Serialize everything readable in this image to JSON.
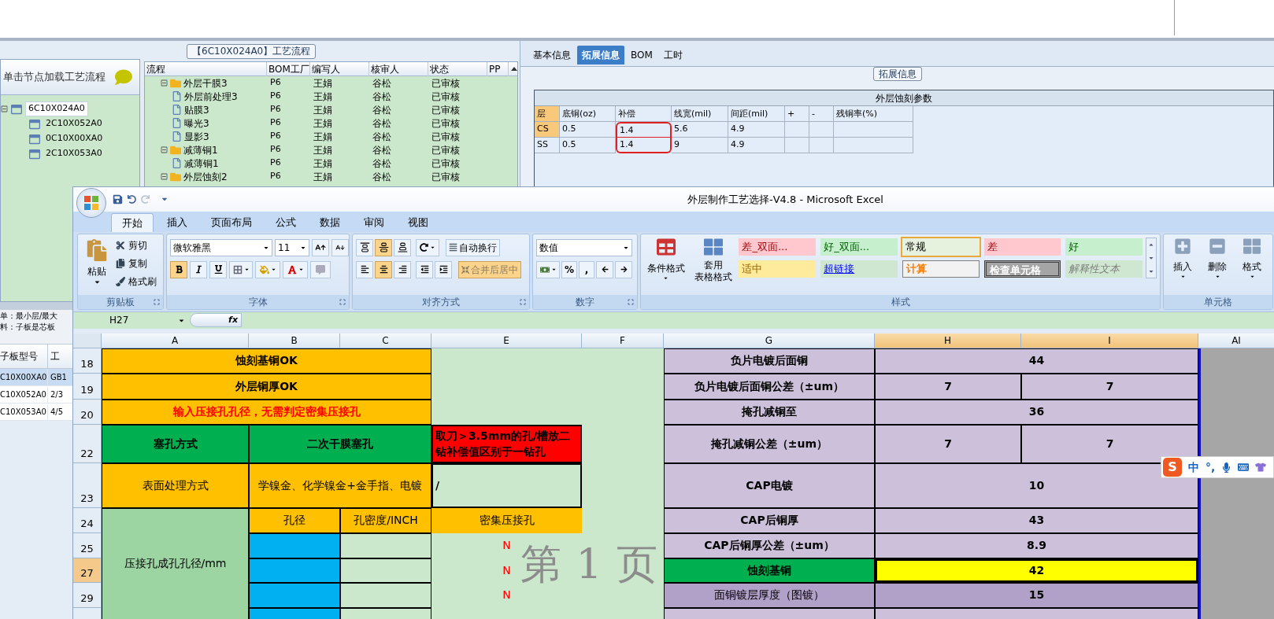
{
  "tree_panel": {
    "title": "单击节点加载工艺流程",
    "nodes": [
      {
        "label": "6C10X024A0",
        "expanded": true,
        "selected": true,
        "children": [
          {
            "label": "2C10X052A0",
            "selected": false
          },
          {
            "label": "0C10X00XA0",
            "selected": false
          },
          {
            "label": "2C10X053A0",
            "selected": false
          }
        ]
      }
    ]
  },
  "process_panel": {
    "title": "【6C10X024A0】工艺流程",
    "columns": [
      "流程",
      "BOM工厂",
      "编写人",
      "核审人",
      "状态",
      "PP"
    ],
    "rows": [
      {
        "kind": "folder",
        "name": "外层干膜3",
        "factory": "P6",
        "writer": "王娟",
        "reviewer": "谷松",
        "status": "已审核",
        "expanded": true,
        "children": [
          {
            "kind": "step",
            "name": "外层前处理3",
            "factory": "P6",
            "writer": "王娟",
            "reviewer": "谷松",
            "status": "已审核"
          },
          {
            "kind": "step",
            "name": "贴膜3",
            "factory": "P6",
            "writer": "王娟",
            "reviewer": "谷松",
            "status": "已审核"
          },
          {
            "kind": "step",
            "name": "曝光3",
            "factory": "P6",
            "writer": "王娟",
            "reviewer": "谷松",
            "status": "已审核"
          },
          {
            "kind": "step",
            "name": "显影3",
            "factory": "P6",
            "writer": "王娟",
            "reviewer": "谷松",
            "status": "已审核"
          }
        ]
      },
      {
        "kind": "folder",
        "name": "减薄铜1",
        "factory": "P6",
        "writer": "王娟",
        "reviewer": "谷松",
        "status": "已审核",
        "expanded": true,
        "children": [
          {
            "kind": "step",
            "name": "减薄铜1",
            "factory": "P6",
            "writer": "王娟",
            "reviewer": "谷松",
            "status": "已审核"
          }
        ]
      },
      {
        "kind": "folder",
        "name": "外层蚀刻2",
        "factory": "P6",
        "writer": "王娟",
        "reviewer": "谷松",
        "status": "已审核",
        "expanded": true
      }
    ]
  },
  "background_list": {
    "lines": [
      "单：最小层/最大",
      "料：子板是芯板"
    ],
    "columns": [
      "子板型号",
      "工"
    ],
    "rows": [
      {
        "cells": [
          "C10X00XA0",
          "GB1"
        ],
        "selected": true
      },
      {
        "cells": [
          "C10X052A0",
          "2/3"
        ],
        "selected": false
      },
      {
        "cells": [
          "C10X053A0",
          "4/5"
        ],
        "selected": false
      }
    ]
  },
  "detail_panel": {
    "tabs": [
      {
        "label": "基本信息",
        "selected": false
      },
      {
        "label": "拓展信息",
        "selected": true
      },
      {
        "label": "BOM",
        "selected": false
      },
      {
        "label": "工时",
        "selected": false
      }
    ],
    "group_title": "拓展信息",
    "table": {
      "title": "外层蚀刻参数",
      "columns": [
        "层",
        "底铜(oz)",
        "补偿",
        "线宽(mil)",
        "间距(mil)",
        "+",
        "-",
        "残铜率(%)"
      ],
      "rows": [
        {
          "selected": true,
          "cells": [
            {
              "text": "CS",
              "circled": false
            },
            {
              "text": "0.5",
              "circled": false
            },
            {
              "text": "1.4",
              "circled": true
            },
            {
              "text": "5.6",
              "circled": false
            },
            {
              "text": "4.9",
              "circled": false
            }
          ]
        },
        {
          "selected": false,
          "cells": [
            {
              "text": "SS",
              "circled": false
            },
            {
              "text": "0.5",
              "circled": false
            },
            {
              "text": "1.4",
              "circled": true
            },
            {
              "text": "9",
              "circled": false
            },
            {
              "text": "4.9",
              "circled": false
            }
          ]
        }
      ]
    }
  },
  "excel": {
    "title": "外层制作工艺选择-V4.8 - Microsoft Excel",
    "tabs": [
      {
        "label": "开始",
        "selected": true
      },
      {
        "label": "插入",
        "selected": false
      },
      {
        "label": "页面布局",
        "selected": false
      },
      {
        "label": "公式",
        "selected": false
      },
      {
        "label": "数据",
        "selected": false
      },
      {
        "label": "审阅",
        "selected": false
      },
      {
        "label": "视图",
        "selected": false
      }
    ],
    "ribbon": {
      "clipboard": {
        "label": "剪贴板",
        "paste": "粘贴",
        "items": [
          "剪切",
          "复制",
          "格式刷"
        ]
      },
      "font": {
        "label": "字体",
        "family": "微软雅黑",
        "size": "11",
        "toggles": [
          {
            "kind": "bold",
            "selected": true
          },
          {
            "kind": "italic",
            "selected": false
          },
          {
            "kind": "underline",
            "selected": false
          }
        ]
      },
      "alignment": {
        "label": "对齐方式",
        "vertical": [
          {
            "kind": "top",
            "selected": false
          },
          {
            "kind": "middle",
            "selected": true
          },
          {
            "kind": "bottom",
            "selected": false
          }
        ],
        "horizontal": [
          {
            "kind": "left",
            "selected": false
          },
          {
            "kind": "center",
            "selected": true
          },
          {
            "kind": "right",
            "selected": false
          }
        ],
        "wrap": {
          "label": "自动换行",
          "selected": false
        },
        "merge": {
          "label": "合并后居中",
          "selected": true
        }
      },
      "number": {
        "label": "数字",
        "format": "数值",
        "symbols": [
          "%",
          ","
        ]
      },
      "styles": {
        "label": "样式",
        "conditional": "条件格式",
        "table_format": [
          "套用",
          "表格格式"
        ],
        "gallery": [
          {
            "label": "差_双面...",
            "kind": "bad",
            "selected": false
          },
          {
            "label": "好_双面...",
            "kind": "good",
            "selected": false
          },
          {
            "label": "常规",
            "kind": "normal",
            "selected": true
          },
          {
            "label": "差",
            "kind": "bad",
            "selected": false
          },
          {
            "label": "好",
            "kind": "good",
            "selected": false
          },
          {
            "label": "适中",
            "kind": "neutral",
            "selected": false
          },
          {
            "label": "超链接",
            "kind": "link",
            "selected": false
          },
          {
            "label": "计算",
            "kind": "calc",
            "selected": false
          },
          {
            "label": "检查单元格",
            "kind": "check",
            "selected": false
          },
          {
            "label": "解释性文本",
            "kind": "explain",
            "selected": false
          }
        ]
      },
      "cells": {
        "label": "单元格",
        "items": [
          "插入",
          "删除",
          "格式"
        ]
      }
    },
    "name_box": "H27",
    "formula_label": "fx",
    "sheet": {
      "columns": [
        {
          "label": "A",
          "selected": false
        },
        {
          "label": "B",
          "selected": false
        },
        {
          "label": "C",
          "selected": false
        },
        {
          "label": "E",
          "selected": false
        },
        {
          "label": "F",
          "selected": false
        },
        {
          "label": "G",
          "selected": false
        },
        {
          "label": "H",
          "selected": true
        },
        {
          "label": "I",
          "selected": true
        },
        {
          "label": "AI",
          "selected": false
        }
      ],
      "rows": [
        {
          "label": "18",
          "selected": false
        },
        {
          "label": "19",
          "selected": false
        },
        {
          "label": "20",
          "selected": false
        },
        {
          "label": "22",
          "selected": false
        },
        {
          "label": "23",
          "selected": false
        },
        {
          "label": "24",
          "selected": false
        },
        {
          "label": "25",
          "selected": false
        },
        {
          "label": "27",
          "selected": true
        },
        {
          "label": "29",
          "selected": false
        }
      ],
      "cells": [
        {
          "text": "蚀刻基铜OK",
          "color": "#ffc000",
          "selected": false
        },
        {
          "text": "负片电镀后面铜",
          "color": "#ccc0da",
          "selected": false
        },
        {
          "text": "44",
          "color": "#ccc0da",
          "selected": false
        },
        {
          "text": "外层铜厚OK",
          "color": "#ffc000",
          "selected": false
        },
        {
          "text": "负片电镀后面铜公差（±um）",
          "color": "#ccc0da",
          "selected": false
        },
        {
          "text": "7",
          "color": "#ccc0da",
          "selected": false
        },
        {
          "text": "7",
          "color": "#ccc0da",
          "selected": false
        },
        {
          "text": "输入压接孔孔径，无需判定密集压接孔",
          "color": "#ffc000",
          "selected": false
        },
        {
          "text": "掩孔减铜至",
          "color": "#ccc0da",
          "selected": false
        },
        {
          "text": "36",
          "color": "#ccc0da",
          "selected": false
        },
        {
          "text": "塞孔方式",
          "color": "#00b050",
          "selected": false
        },
        {
          "text": "二次干膜塞孔",
          "color": "#00b050",
          "selected": false
        },
        {
          "text": "取刀＞3.5mm的孔/槽放二钻补偿值区别于一钻孔",
          "color": "#ff0000",
          "selected": false
        },
        {
          "text": "掩孔减铜公差（±um）",
          "color": "#ccc0da",
          "selected": false
        },
        {
          "text": "7",
          "color": "#ccc0da",
          "selected": false
        },
        {
          "text": "7",
          "color": "#ccc0da",
          "selected": false
        },
        {
          "text": "表面处理方式",
          "color": "#ffc000",
          "selected": false
        },
        {
          "text": "学镍金、化学镍金+金手指、电镀",
          "color": "#ffc000",
          "selected": false
        },
        {
          "text": "/",
          "color": "#cce8cc",
          "selected": false
        },
        {
          "text": "CAP电镀",
          "color": "#ccc0da",
          "selected": false
        },
        {
          "text": "10",
          "color": "#ccc0da",
          "selected": false
        },
        {
          "text": "压接孔成孔孔径/mm",
          "color": "#9dd5a2",
          "selected": false
        },
        {
          "text": "孔径",
          "color": "#ffc000",
          "selected": false
        },
        {
          "text": "孔密度/INCH",
          "color": "#ffc000",
          "selected": false
        },
        {
          "text": "密集压接孔",
          "color": "#ffc000",
          "selected": false
        },
        {
          "text": "CAP后铜厚",
          "color": "#ccc0da",
          "selected": false
        },
        {
          "text": "43",
          "color": "#ccc0da",
          "selected": false
        },
        {
          "color": "#00b0f0",
          "selected": false
        },
        {
          "color": "#cce8cc",
          "selected": false
        },
        {
          "text": "N",
          "selected": false
        },
        {
          "text": "CAP后铜厚公差（±um）",
          "color": "#ccc0da",
          "selected": false
        },
        {
          "text": "8.9",
          "color": "#ccc0da",
          "selected": false
        },
        {
          "color": "#00b0f0",
          "selected": false
        },
        {
          "color": "#cce8cc",
          "selected": false
        },
        {
          "text": "N",
          "selected": false
        },
        {
          "text": "蚀刻基铜",
          "color": "#00b050",
          "selected": false
        },
        {
          "text": "42",
          "color": "#ffff00",
          "selected": true
        },
        {
          "color": "#00b0f0",
          "selected": false
        },
        {
          "color": "#cce8cc",
          "selected": false
        },
        {
          "text": "N",
          "selected": false
        },
        {
          "text": "面铜镀层厚度（图镀）",
          "color": "#b1a0c7",
          "selected": false
        },
        {
          "text": "15",
          "color": "#b1a0c7",
          "selected": false
        },
        {
          "color": "#00b0f0",
          "selected": false
        },
        {
          "color": "#cce8cc",
          "selected": false
        },
        {
          "color": "#ccc0da",
          "selected": false
        },
        {
          "color": "#ccc0da",
          "selected": false
        }
      ]
    },
    "watermark": "第 1 页"
  },
  "ime_bar": {
    "logo": "S",
    "labels": [
      "中",
      "°,"
    ]
  }
}
